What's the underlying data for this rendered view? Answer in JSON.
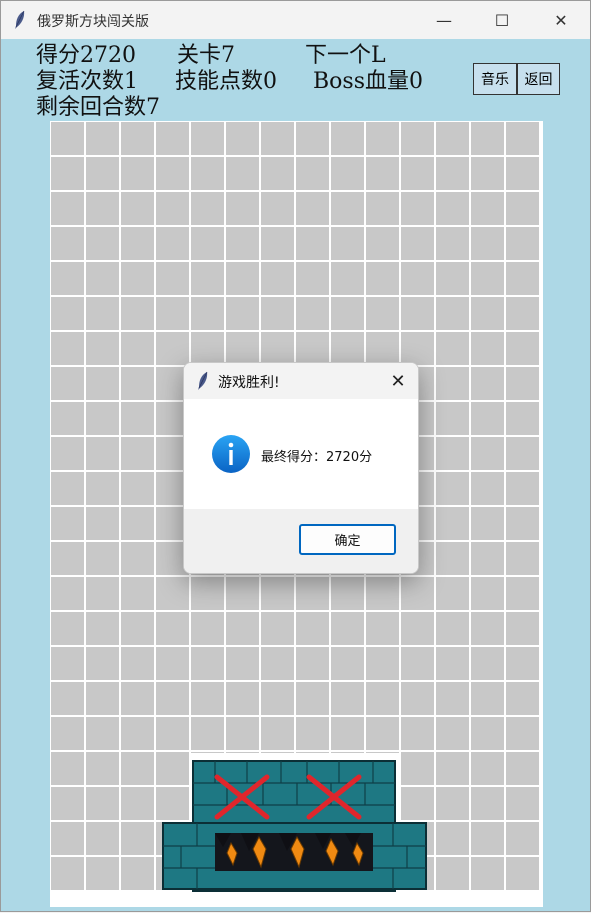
{
  "window": {
    "title": "俄罗斯方块闯关版",
    "minimize_glyph": "—",
    "maximize_glyph": "☐",
    "close_glyph": "✕"
  },
  "hud": {
    "score": "得分2720",
    "level": "关卡7",
    "next_piece": "下一个L",
    "revives": "复活次数1",
    "skill_points": "技能点数0",
    "boss_hp": "Boss血量0",
    "remaining_turns": "剩余回合数7"
  },
  "buttons": {
    "music": "音乐",
    "back": "返回"
  },
  "board": {
    "columns": 14,
    "rows": 22,
    "cell_color": "#c8c8c8",
    "line_color": "#ffffff",
    "boss": "defeated-boss-block-monster"
  },
  "dialog": {
    "title": "游戏胜利!",
    "message": "最终得分：2720分",
    "ok_label": "确定",
    "icon": "info-icon",
    "close_glyph": "✕"
  },
  "colors": {
    "window_bg": "#add8e6",
    "accent": "#0067c0",
    "boss_teal": "#1f7f8c",
    "boss_x_red": "#e0262c",
    "boss_teeth_orange": "#f08a12"
  }
}
